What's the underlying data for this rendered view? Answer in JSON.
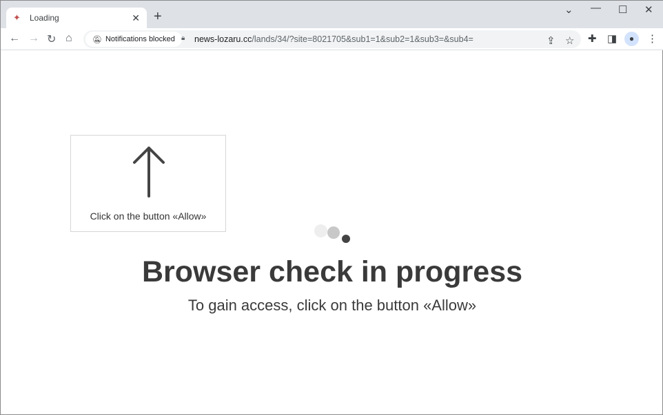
{
  "tab": {
    "title": "Loading",
    "favicon": "megaphone-icon"
  },
  "toolbar": {
    "notification_chip": "Notifications blocked",
    "url_domain": "news-lozaru.cc",
    "url_path": "/lands/34/?site=8021705&sub1=1&sub2=1&sub3=&sub4="
  },
  "content": {
    "hint": "Click on the button «Allow»",
    "heading": "Browser check in progress",
    "subheading": "To gain access, click on the button «Allow»"
  },
  "colors": {
    "text": "#3a3a3a",
    "tabstrip": "#dee1e6"
  }
}
